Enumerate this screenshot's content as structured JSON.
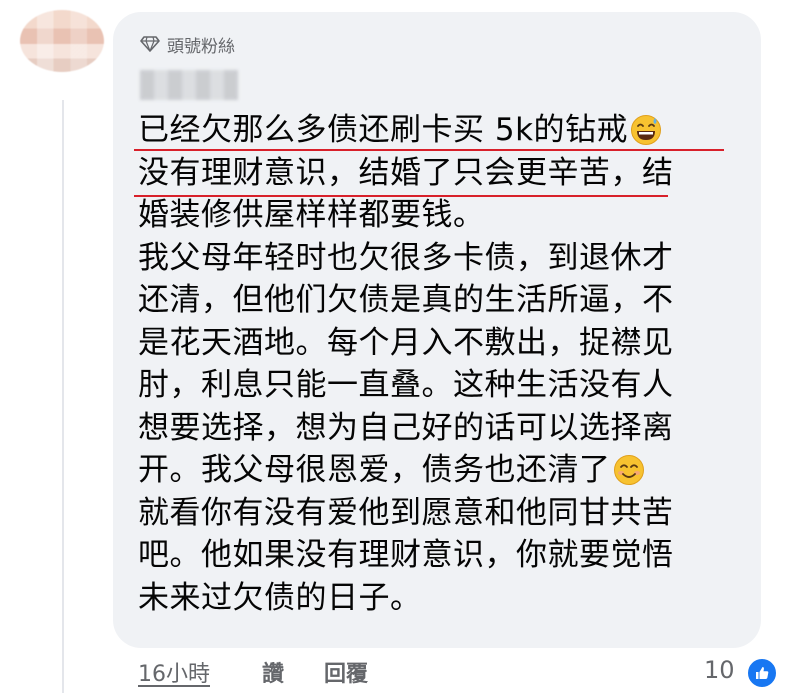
{
  "badge": {
    "icon": "diamond-icon",
    "label": "頭號粉絲"
  },
  "comment": {
    "lines": [
      "已经欠那么多债还刷卡买 5k的钻戒",
      "没有理财意识，结婚了只会更辛苦，结",
      "婚装修供屋样样都要钱。",
      "我父母年轻时也欠很多卡债，到退休才",
      "还清，但他们欠债是真的生活所逼，不",
      "是花天酒地。每个月入不敷出，捉襟见",
      "肘，利息只能一直叠。这种生活没有人",
      "想要选择，想为自己好的话可以选择离",
      "开。我父母很恩爱，债务也还清了",
      "就看你有没有爱他到愿意和他同甘共苦",
      "吧。他如果没有理财意识，你就要觉悟",
      "未来过欠债的日子。"
    ],
    "emoji_1": "grinning-sweat-emoji",
    "emoji_2": "smiling-face-emoji",
    "highlight_color": "#d8202a"
  },
  "footer": {
    "time": "16小時",
    "like": "讚",
    "reply": "回覆"
  },
  "reactions": {
    "count": "10",
    "icon": "thumbs-up-icon",
    "color": "#1877f2"
  }
}
